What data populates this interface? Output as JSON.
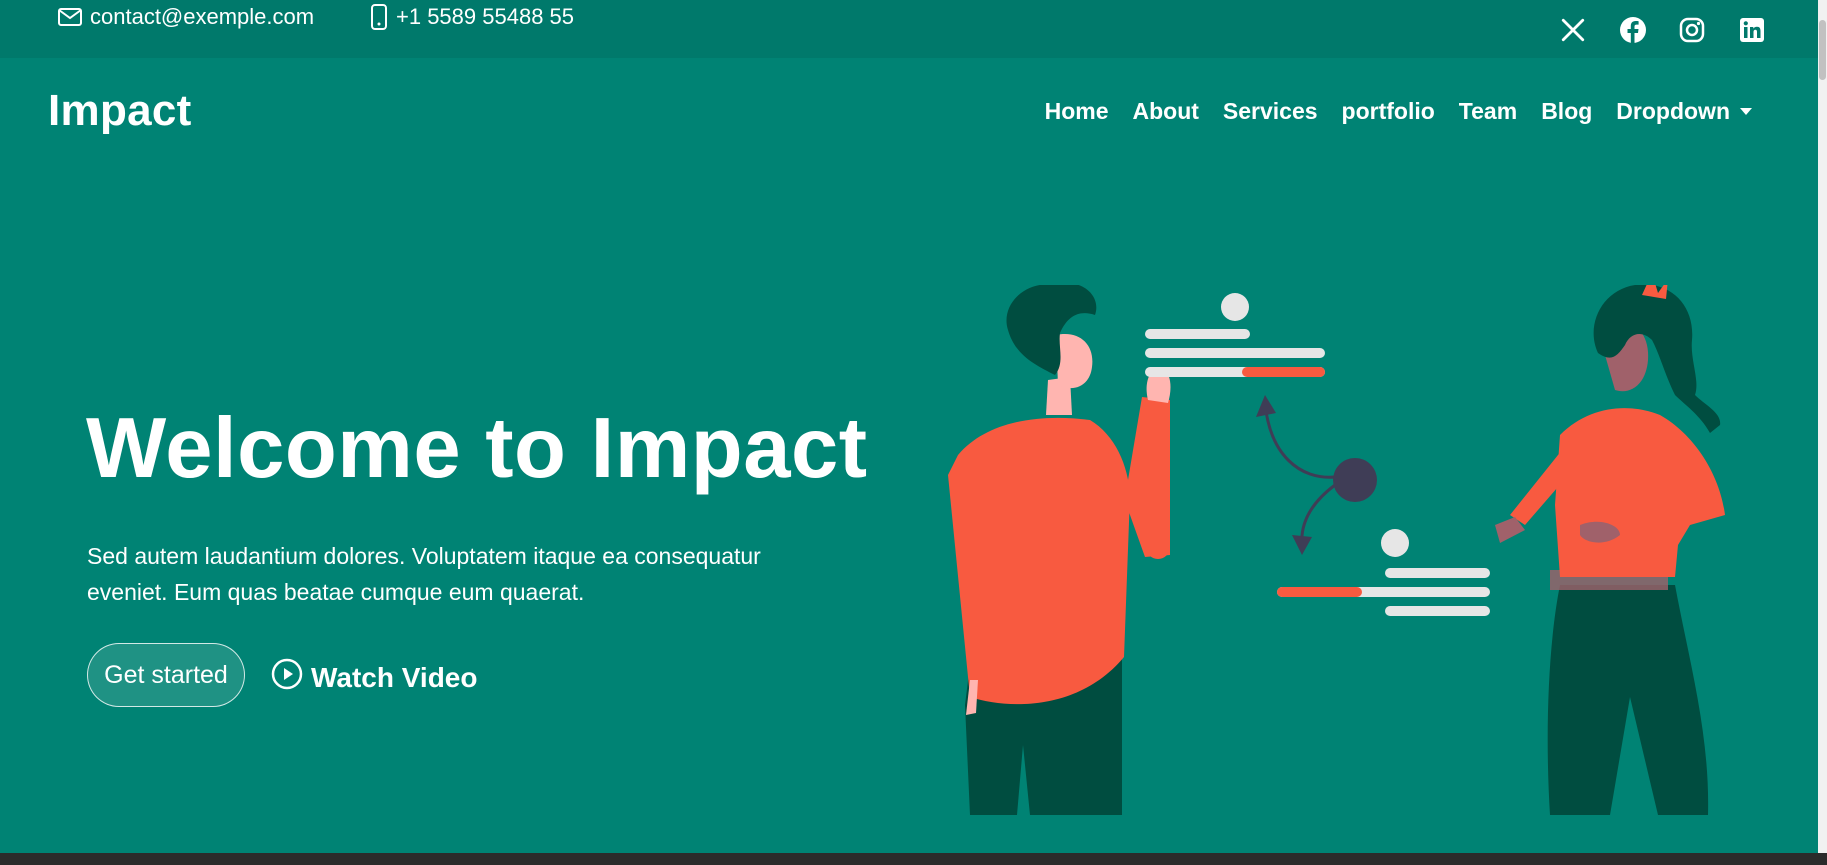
{
  "topbar": {
    "email": "contact@exemple.com",
    "phone": "+1 5589 55488 55",
    "social_icons": [
      "x-twitter-icon",
      "facebook-icon",
      "instagram-icon",
      "linkedin-icon"
    ]
  },
  "header": {
    "logo": "Impact",
    "nav": [
      {
        "label": "Home"
      },
      {
        "label": "About"
      },
      {
        "label": "Services"
      },
      {
        "label": "portfolio"
      },
      {
        "label": "Team"
      },
      {
        "label": "Blog"
      },
      {
        "label": "Dropdown"
      }
    ]
  },
  "hero": {
    "title": "Welcome to Impact",
    "text": "Sed autem laudantium dolores. Voluptatem itaque ea consequatur eveniet. Eum quas beatae cumque eum quaerat.",
    "primary_button": "Get started",
    "video_button": "Watch Video"
  },
  "colors": {
    "background": "#008374",
    "topbar": "#00796b",
    "accent": "#f85a40",
    "dark_green": "#004d40",
    "text": "#ffffff"
  }
}
